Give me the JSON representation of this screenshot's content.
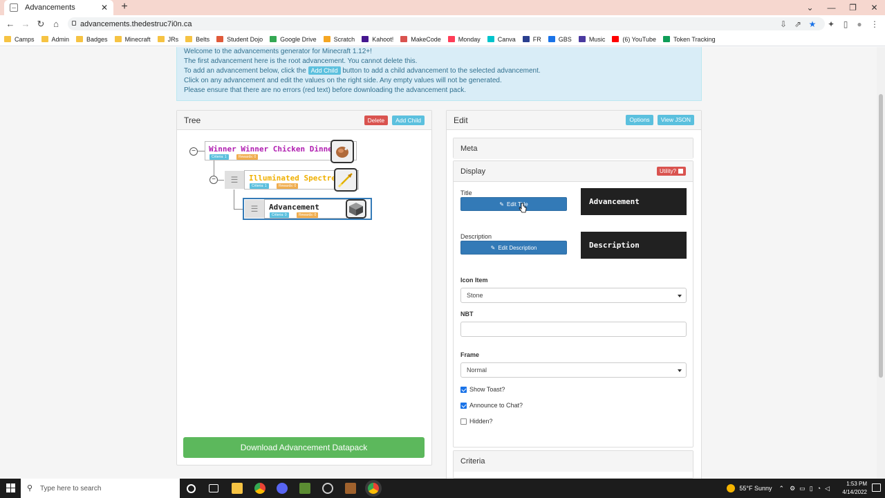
{
  "browser": {
    "tab_title": "Advancements",
    "url": "advancements.thedestruc7i0n.ca",
    "bookmarks": [
      {
        "label": "Camps",
        "icon": "folder-icon"
      },
      {
        "label": "Admin",
        "icon": "folder-icon"
      },
      {
        "label": "Badges",
        "icon": "folder-icon"
      },
      {
        "label": "Minecraft",
        "icon": "folder-icon"
      },
      {
        "label": "JRs",
        "icon": "folder-icon"
      },
      {
        "label": "Belts",
        "icon": "folder-icon"
      },
      {
        "label": "Student Dojo",
        "icon": "dojo-icon"
      },
      {
        "label": "Google Drive",
        "icon": "drive-icon"
      },
      {
        "label": "Scratch",
        "icon": "scratch-icon"
      },
      {
        "label": "Kahoot!",
        "icon": "kahoot-icon"
      },
      {
        "label": "MakeCode",
        "icon": "makecode-icon"
      },
      {
        "label": "Monday",
        "icon": "monday-icon"
      },
      {
        "label": "Canva",
        "icon": "canva-icon"
      },
      {
        "label": "FR",
        "icon": "fr-icon"
      },
      {
        "label": "GBS",
        "icon": "gbs-icon"
      },
      {
        "label": "Music",
        "icon": "music-icon"
      },
      {
        "label": "(6) YouTube",
        "icon": "youtube-icon"
      },
      {
        "label": "Token Tracking",
        "icon": "sheets-icon"
      }
    ]
  },
  "info": {
    "line1": "Welcome to the advancements generator for Minecraft 1.12+!",
    "line2": "The first advancement here is the root advancement. You cannot delete this.",
    "line3_pre": "To add an advancement below, click the",
    "line3_badge": "Add Child",
    "line3_post": "button to add a child advancement to the selected advancement.",
    "line4": "Click on any advancement and edit the values on the right side. Any empty values will not be generated.",
    "line5": "Please ensure that there are no errors (red text) before downloading the advancement pack."
  },
  "tree": {
    "heading": "Tree",
    "delete_label": "Delete",
    "add_child_label": "Add Child",
    "nodes": [
      {
        "title": "Winner Winner Chicken Dinner",
        "criteria": "Criteria: 1",
        "rewards": "Rewards: 0",
        "color": "#b01eb0",
        "icon": "cooked-chicken-icon"
      },
      {
        "title": "Illuminated Spectre",
        "criteria": "Criteria: 1",
        "rewards": "Rewards: 0",
        "color": "#f0b000",
        "icon": "spectral-arrow-icon"
      },
      {
        "title": "Advancement",
        "criteria": "Criteria: 0",
        "rewards": "Rewards: 0",
        "color": "#222222",
        "icon": "stone-icon"
      }
    ],
    "download_label": "Download Advancement Datapack"
  },
  "edit": {
    "heading": "Edit",
    "options_label": "Options",
    "view_json_label": "View JSON",
    "meta_label": "Meta",
    "display_label": "Display",
    "utility_label": "Utility?",
    "title_label": "Title",
    "edit_title_label": "Edit Title",
    "title_preview": "Advancement",
    "description_label": "Description",
    "edit_description_label": "Edit Description",
    "description_preview": "Description",
    "icon_item_label": "Icon Item",
    "icon_item_value": "Stone",
    "nbt_label": "NBT",
    "nbt_value": "",
    "frame_label": "Frame",
    "frame_value": "Normal",
    "show_toast_label": "Show Toast?",
    "show_toast": true,
    "announce_label": "Announce to Chat?",
    "announce": true,
    "hidden_label": "Hidden?",
    "hidden": false,
    "criteria_label": "Criteria"
  },
  "taskbar": {
    "search_placeholder": "Type here to search",
    "weather": "55°F Sunny",
    "time": "1:53 PM",
    "date": "4/14/2022"
  }
}
